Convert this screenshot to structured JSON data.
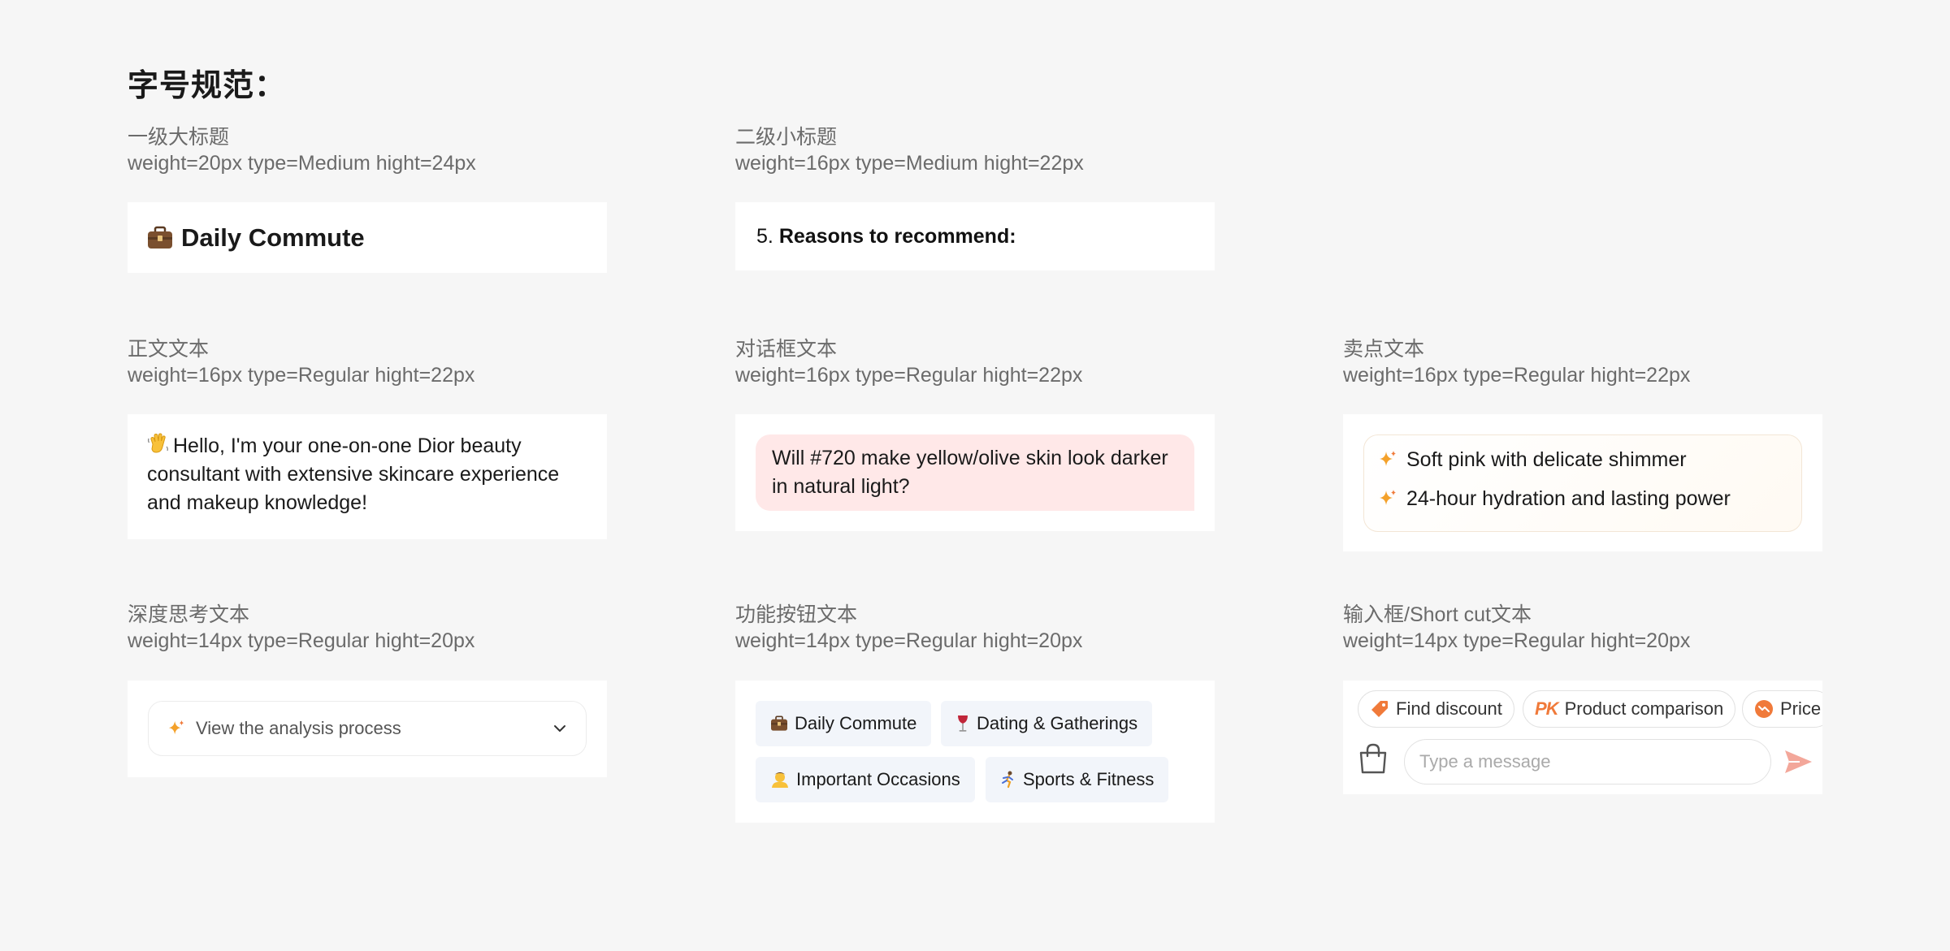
{
  "page_title": "字号规范：",
  "sections": {
    "h1": {
      "name": "一级大标题",
      "spec": "weight=20px type=Medium hight=24px",
      "sample": "Daily Commute"
    },
    "h2": {
      "name": "二级小标题",
      "spec": "weight=16px type=Medium hight=22px",
      "sample_num": "5.",
      "sample": "Reasons to recommend:"
    },
    "body": {
      "name": "正文文本",
      "spec": "weight=16px type=Regular hight=22px",
      "sample": "Hello, I'm your one-on-one Dior beauty consultant with extensive skincare experience and makeup knowledge!"
    },
    "dialog": {
      "name": "对话框文本",
      "spec": "weight=16px type=Regular hight=22px",
      "sample": "Will #720 make yellow/olive skin look darker in natural light?"
    },
    "selling": {
      "name": "卖点文本",
      "spec": "weight=16px type=Regular hight=22px",
      "items": [
        "Soft pink with delicate shimmer",
        "24-hour hydration and lasting power"
      ]
    },
    "thinking": {
      "name": "深度思考文本",
      "spec": "weight=14px type=Regular hight=20px",
      "label": "View the analysis process"
    },
    "buttons": {
      "name": "功能按钮文本",
      "spec": "weight=14px type=Regular hight=20px",
      "chips": [
        "Daily Commute",
        "Dating & Gatherings",
        "Important Occasions",
        "Sports & Fitness"
      ]
    },
    "input": {
      "name": "输入框/Short cut文本",
      "spec": "weight=14px type=Regular hight=20px",
      "shortcuts": [
        "Find discount",
        "Product comparison",
        "Price"
      ],
      "pk_glyph": "PK",
      "placeholder": "Type a message"
    }
  },
  "colors": {
    "accent_orange": "#f07a3a",
    "bubble_bg": "#ffe8e8",
    "chip_bg": "#f2f5fa",
    "send_icon": "#f3a79a"
  },
  "icons": {
    "h1": "briefcase-icon",
    "body": "waving-hand-icon",
    "selling": "sparkle-icon",
    "thinking": [
      "sparkle-icon",
      "chevron-down-icon"
    ],
    "chips": [
      "briefcase-icon",
      "wine-glass-icon",
      "person-bowing-icon",
      "running-person-icon"
    ],
    "input": [
      "tag-icon",
      "pk-icon",
      "price-trend-icon",
      "shopping-bag-icon",
      "send-icon"
    ]
  }
}
